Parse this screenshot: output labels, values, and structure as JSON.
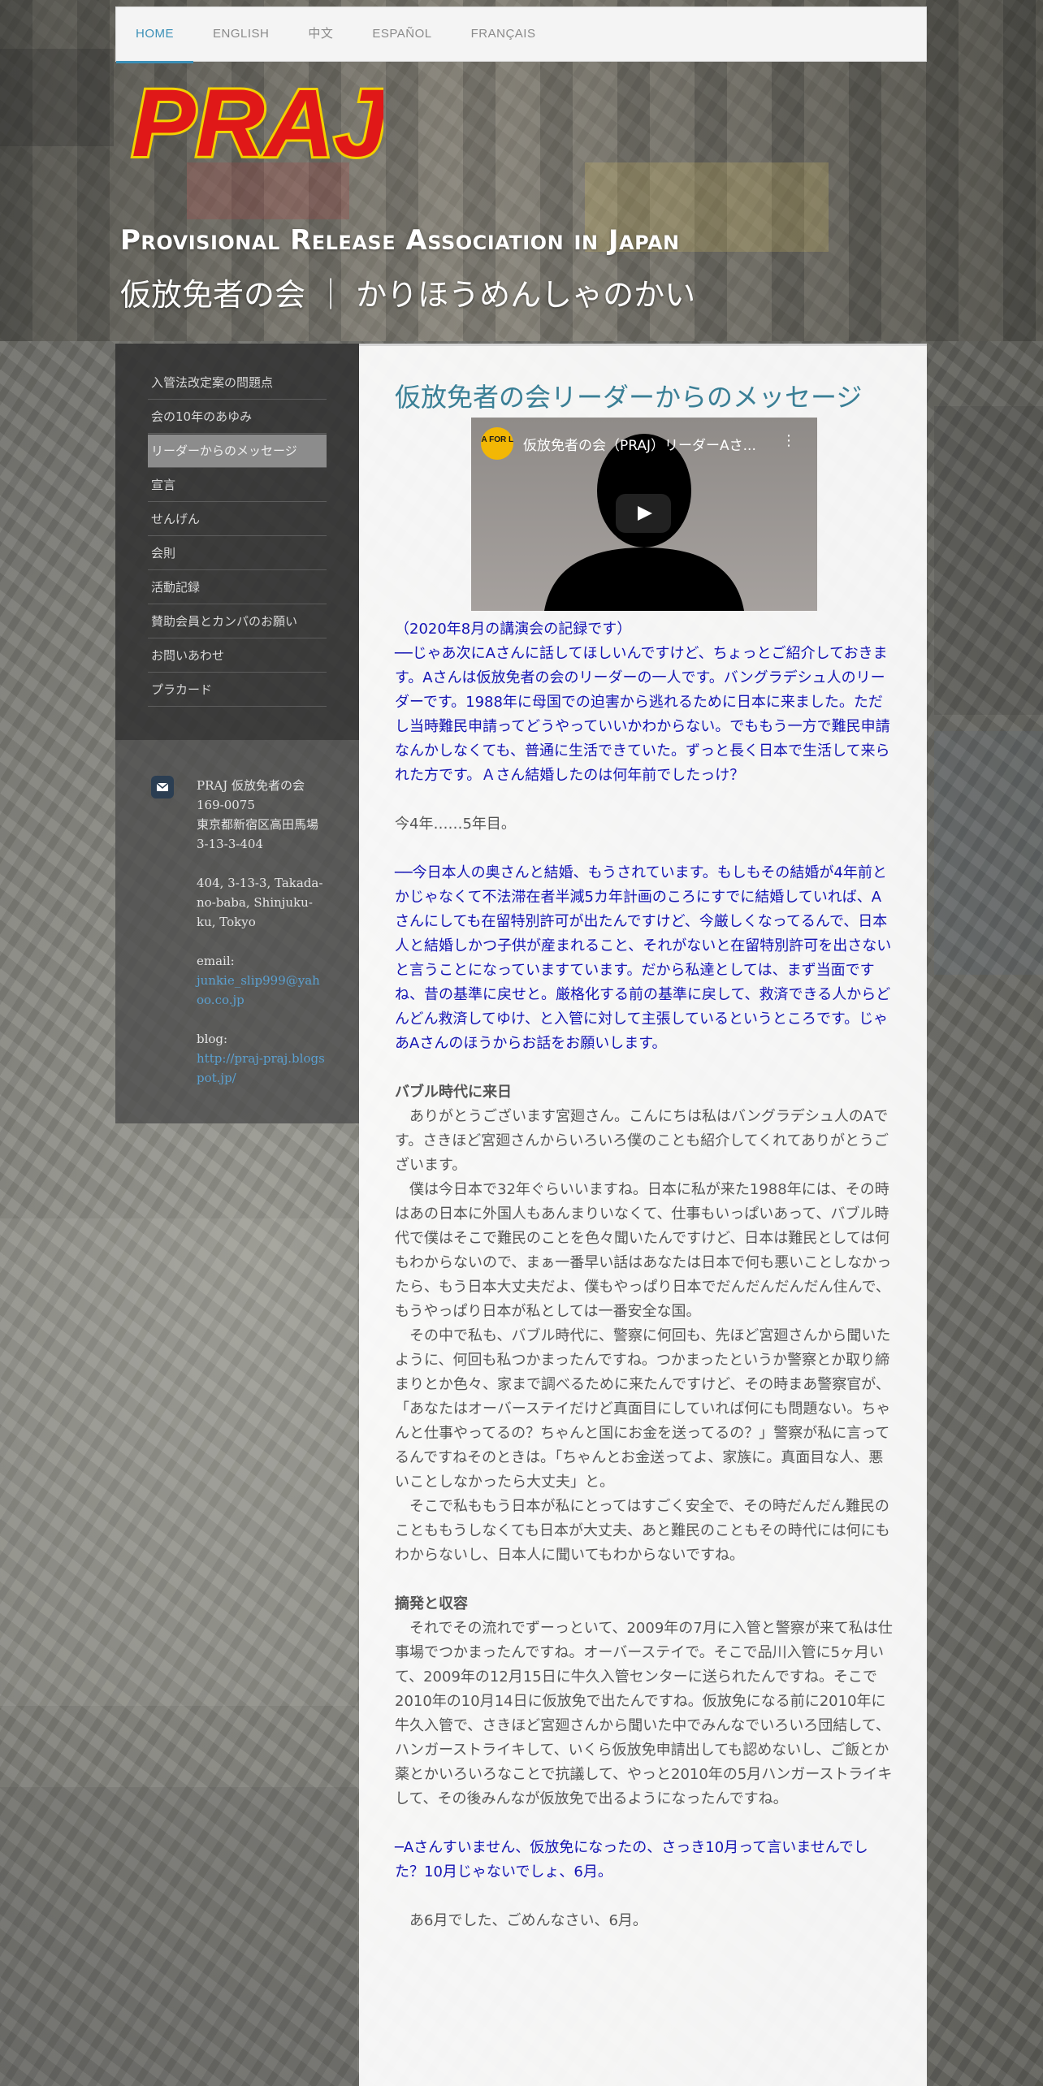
{
  "nav": {
    "items": [
      "HOME",
      "ENGLISH",
      "中文",
      "ESPAÑOL",
      "FRANÇAIS"
    ]
  },
  "header": {
    "logo_text": "PRAJ",
    "title": "Provisional Release Association in Japan",
    "subtitle": "仮放免者の会 ｜ かりほうめんしゃのかい"
  },
  "sidebar": {
    "menu": [
      "入管法改定案の問題点",
      "会の10年のあゆみ",
      "リーダーからのメッセージ",
      "宣言",
      "せんげん",
      "会則",
      "活動記録",
      "賛助会員とカンパのお願い",
      "お問いあわせ",
      "プラカード"
    ],
    "contact": {
      "name": "PRAJ 仮放免者の会",
      "postal": "169-0075",
      "address_jp": "東京都新宿区高田馬場3-13-3-404",
      "address_en": "404, 3-13-3, Takada-no-baba, Shinjuku-ku, Tokyo",
      "email_label": "email:",
      "email": "junkie_slip999@yahoo.co.jp",
      "blog_label": "blog:",
      "blog": "http://praj-praj.blogspot.jp/"
    }
  },
  "main": {
    "title": "仮放免者の会リーダーからのメッセージ",
    "video": {
      "badge": "VISA FOR LIFE",
      "title": "仮放免者の会（PRAJ）リーダーAさ..."
    },
    "intro_note": "（2020年8月の講演会の記録です）",
    "q1": "──じゃあ次にAさんに話してほしいんですけど、ちょっとご紹介しておきます。Aさんは仮放免者の会のリーダーの一人です。バングラデシュ人のリーダーです。1988年に母国での迫害から逃れるために日本に来ました。ただし当時難民申請ってどうやっていいかわからない。でももう一方で難民申請なんかしなくても、普通に生活できていた。ずっと長く日本で生活して来られた方です。Ａさん結婚したのは何年前でしたっけ？",
    "a1": "今4年……5年目。",
    "q2": "──今日本人の奥さんと結婚、もうされています。もしもその結婚が4年前とかじゃなくて不法滞在者半減5カ年計画のころにすでに結婚していれば、Aさんにしても在留特別許可が出たんですけど、今厳しくなってるんで、日本人と結婚しかつ子供が産まれること、それがないと在留特別許可を出さないと言うことになっていますています。だから私達としては、まず当面ですね、昔の基準に戻せと。厳格化する前の基準に戻して、救済できる人からどんどん救済してゆけ、と入管に対して主張しているというところです。じゃあAさんのほうからお話をお願いします。",
    "section1_title": "バブル時代に来日",
    "section1_paras": [
      "ありがとうございます宮廻さん。こんにちは私はバングラデシュ人のAです。さきほど宮廻さんからいろいろ僕のことも紹介してくれてありがとうございます。",
      "僕は今日本で32年ぐらいいますね。日本に私が来た1988年には、その時はあの日本に外国人もあんまりいなくて、仕事もいっぱいあって、バブル時代で僕はそこで難民のことを色々聞いたんですけど、日本は難民としては何もわからないので、まぁ一番早い話はあなたは日本で何も悪いことしなかったら、もう日本大丈夫だよ、僕もやっぱり日本でだんだんだんだん住んで、もうやっぱり日本が私としては一番安全な国。",
      "その中で私も、バブル時代に、警察に何回も、先ほど宮廻さんから聞いたように、何回も私つかまったんですね。つかまったというか警察とか取り締まりとか色々、家まで調べるために来たんですけど、その時まあ警察官が、「あなたはオーバーステイだけど真面目にしていれば何にも問題ない。ちゃんと仕事やってるの？ちゃんと国にお金を送ってるの？」警察が私に言ってるんですねそのときは。「ちゃんとお金送ってよ、家族に。真面目な人、悪いことしなかったら大丈夫」と。",
      "そこで私ももう日本が私にとってはすごく安全で、その時だんだん難民のことももうしなくても日本が大丈夫、あと難民のこともその時代には何にもわからないし、日本人に聞いてもわからないですね。"
    ],
    "section2_title": "摘発と収容",
    "section2_paras": [
      "それでその流れでずーっといて、2009年の7月に入管と警察が来て私は仕事場でつかまったんですね。オーバーステイで。そこで品川入管に5ヶ月いて、2009年の12月15日に牛久入管センターに送られたんですね。そこで2010年の10月14日に仮放免で出たんですね。仮放免になる前に2010年に牛久入管で、さきほど宮廻さんから聞いた中でみんなでいろいろ団結して、ハンガーストライキして、いくら仮放免申請出しても認めないし、ご飯とか薬とかいろいろなことで抗議して、やっと2010年の5月ハンガーストライキして、その後みんなが仮放免で出るようになったんですね。"
    ],
    "q3": "─Aさんすいません、仮放免になったの、さっき10月って言いませんでした？10月じゃないでしょ、6月。",
    "a3": "あ6月でした、ごめんなさい、6月。"
  }
}
